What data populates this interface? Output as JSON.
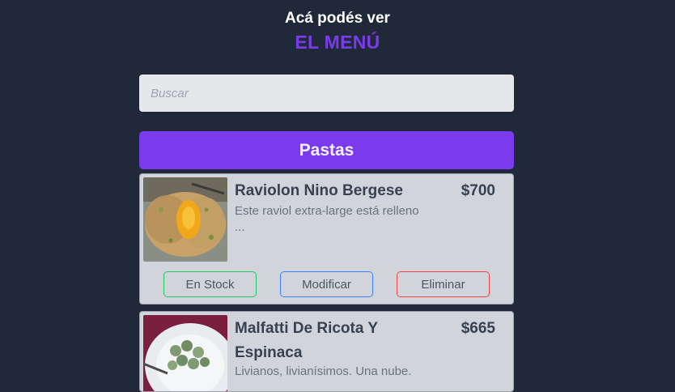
{
  "header": {
    "subtitle": "Acá podés ver",
    "title": "EL MENÚ"
  },
  "search": {
    "placeholder": "Buscar",
    "value": ""
  },
  "categories": [
    {
      "name": "Pastas",
      "items": [
        {
          "name": "Raviolon Nino Bergese",
          "price": "$700",
          "description_line1": "Este raviol extra-large está relleno",
          "description_line2": "...",
          "image": "ravioli-photo",
          "actions": {
            "stock": "En Stock",
            "edit": "Modificar",
            "delete": "Eliminar"
          }
        },
        {
          "name": "Malfatti De Ricota Y Espinaca",
          "price": "$665",
          "description_line1": "Livianos, livianísimos. Una nube.",
          "image": "malfatti-photo"
        }
      ]
    }
  ],
  "colors": {
    "background": "#202939",
    "accent": "#7c3aed",
    "card": "#d1d5db",
    "stock": "#22c55e",
    "edit": "#3b82f6",
    "delete": "#ef4444"
  }
}
